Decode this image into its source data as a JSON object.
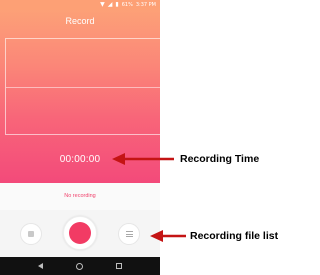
{
  "status_bar": {
    "battery": "61%",
    "time": "3:37 PM"
  },
  "app": {
    "title": "Record",
    "recording_time": "00:00:00",
    "status_text": "No recording"
  },
  "controls": {
    "stop": "stop-icon",
    "record": "record-icon",
    "list": "list-icon"
  },
  "annotations": {
    "time_label": "Recording Time",
    "list_label": "Recording file list"
  },
  "colors": {
    "gradient_top": "#fda577",
    "gradient_bottom": "#f34a7a",
    "record_button": "#f23b64",
    "annotation_arrow": "#c41414"
  }
}
